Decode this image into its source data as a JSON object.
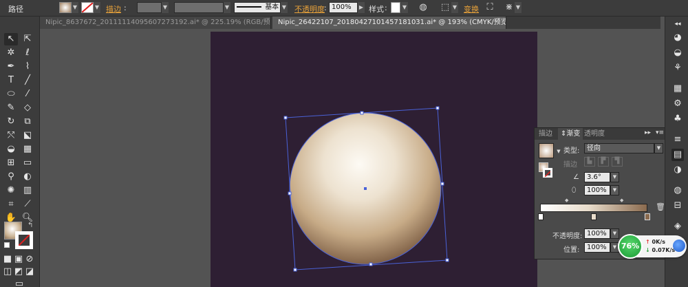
{
  "control_bar": {
    "path_label": "路径",
    "stroke_label": "描边",
    "colon": ":",
    "stroke_style": "基本",
    "opacity_label": "不透明度",
    "opacity_value": "100%",
    "style_label": "样式",
    "transform_label": "变换",
    "accent_color": "#e8a23a"
  },
  "tabs": [
    {
      "label": "Nipic_8637672_20111114095607273192.ai* @ 225.19% (RGB/预览)",
      "close": "×"
    },
    {
      "label": "Nipic_26422107_20180427101457181031.ai* @ 193% (CMYK/预览)",
      "close": "×"
    }
  ],
  "tools": [
    "selection-tool",
    "direct-selection-tool",
    "magic-wand-tool",
    "lasso-tool",
    "pen-tool",
    "curvature-tool",
    "type-tool",
    "line-tool",
    "ellipse-tool",
    "paintbrush-tool",
    "pencil-tool",
    "eraser-tool",
    "rotate-tool",
    "scale-tool",
    "width-tool",
    "free-transform-tool",
    "shape-builder-tool",
    "perspective-grid-tool",
    "mesh-tool",
    "gradient-tool",
    "eyedropper-tool",
    "blend-tool",
    "symbol-sprayer-tool",
    "column-graph-tool",
    "artboard-tool",
    "slice-tool",
    "hand-tool",
    "zoom-tool"
  ],
  "gradient_panel": {
    "tabs": [
      "描边",
      "渐变",
      "透明度"
    ],
    "type_label": "类型:",
    "type_value": "径向",
    "stroke_label": "描边",
    "angle_value": "3.6°",
    "aspect_value": "100%",
    "opacity_label": "不透明度:",
    "opacity_value": "100%",
    "location_label": "位置:",
    "location_value": "100%",
    "gradient_colors": [
      "#ffffff",
      "#e8dccb",
      "#8a6a4e"
    ]
  },
  "network_widget": {
    "percent": "76%",
    "upload": "0K/s",
    "download": "0.07K/s"
  },
  "colors": {
    "artboard": "#2e1f33",
    "sphere_light": "#fbf7f0",
    "sphere_mid": "#d8c4a6",
    "sphere_dark": "#7a5d45",
    "selection": "#4a62d8"
  }
}
